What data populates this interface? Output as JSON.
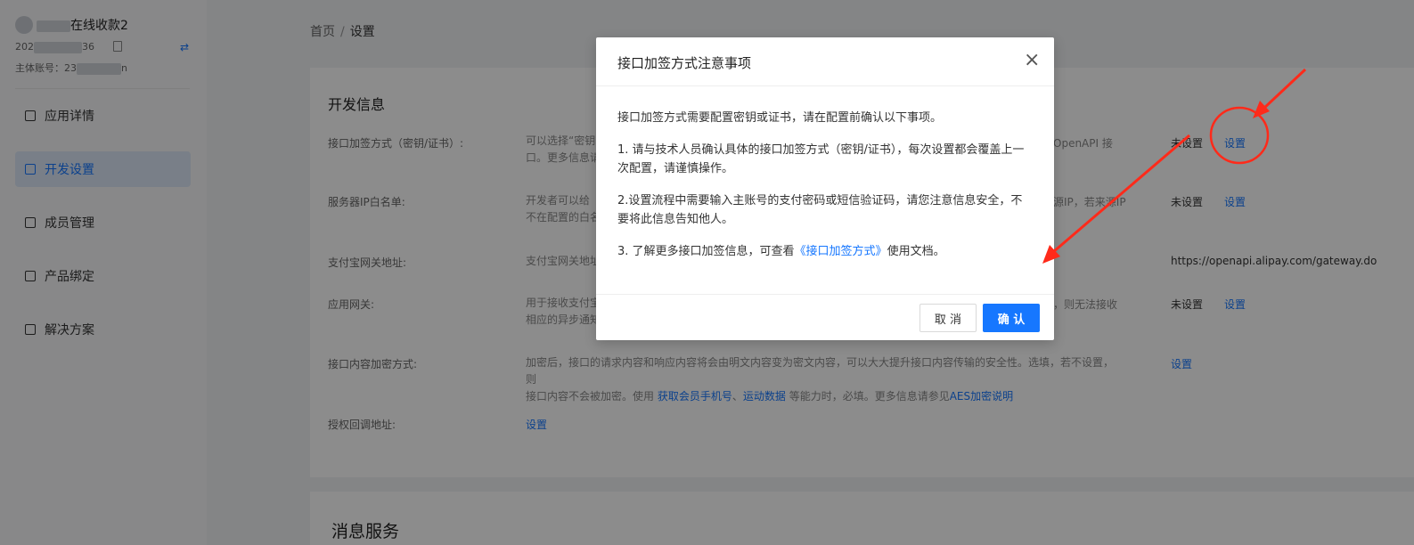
{
  "sidebar": {
    "app_name": "在线收款2",
    "app_id_prefix": "202",
    "app_id_suffix": "36",
    "main_account_label": "主体账号：23",
    "main_account_suffix": "n",
    "nav": [
      {
        "label": "应用详情",
        "icon": "app-detail-icon",
        "active": false
      },
      {
        "label": "开发设置",
        "icon": "dev-settings-icon",
        "active": true
      },
      {
        "label": "成员管理",
        "icon": "members-icon",
        "active": false
      },
      {
        "label": "产品绑定",
        "icon": "product-bind-icon",
        "active": false
      },
      {
        "label": "解决方案",
        "icon": "solution-icon",
        "active": false
      }
    ]
  },
  "breadcrumb": {
    "home": "首页",
    "separator": "/",
    "current": "设置"
  },
  "dev_info": {
    "title": "开发信息",
    "rows": [
      {
        "label": "接口加签方式（密钥/证书）:",
        "desc1": "可以选择“密钥”",
        "desc2": "口。更多信息请",
        "desc_right": "OpenAPI 接",
        "status": "未设置",
        "action": "设置"
      },
      {
        "label": "服务器IP白名单:",
        "desc1": "开发者可以给",
        "desc2": "不在配置的白名",
        "desc_right": "源IP，若来源IP",
        "status": "未设置",
        "action": "设置"
      },
      {
        "label": "支付宝网关地址:",
        "desc1": "支付宝网关地址",
        "value": "https://openapi.alipay.com/gateway.do"
      },
      {
        "label": "应用网关:",
        "desc1": "用于接收支付宝",
        "desc2": "相应的异步通知",
        "desc_right": "，则无法接收",
        "status": "未设置",
        "action": "设置"
      },
      {
        "label": "接口内容加密方式:",
        "desc_line1": "加密后，接口的请求内容和响应内容将会由明文内容变为密文内容，可以大大提升接口内容传输的安全性。选填，若不设置，则",
        "desc_line2_a": "接口内容不会被加密。使用 ",
        "link1": "获取会员手机号",
        "sep": "、",
        "link2": "运动数据",
        "desc_line2_b": " 等能力时，必填。更多信息请参见",
        "link3": "AES加密说明",
        "action": "设置"
      },
      {
        "label": "授权回调地址:",
        "action": "设置"
      }
    ]
  },
  "msg_service": {
    "title": "消息服务"
  },
  "modal": {
    "title": "接口加签方式注意事项",
    "intro": "接口加签方式需要配置密钥或证书，请在配置前确认以下事项。",
    "item1": "1. 请与技术人员确认具体的接口加签方式（密钥/证书），每次设置都会覆盖上一次配置，请谨慎操作。",
    "item2": "2.设置流程中需要输入主账号的支付密码或短信验证码，请您注意信息安全，不要将此信息告知他人。",
    "item3_a": "3. 了解更多接口加签信息，可查看",
    "item3_link": "《接口加签方式》",
    "item3_b": "使用文档。",
    "close_icon": "×",
    "cancel": "取 消",
    "ok": "确 认"
  },
  "annotation_color": "#ff2a1a"
}
